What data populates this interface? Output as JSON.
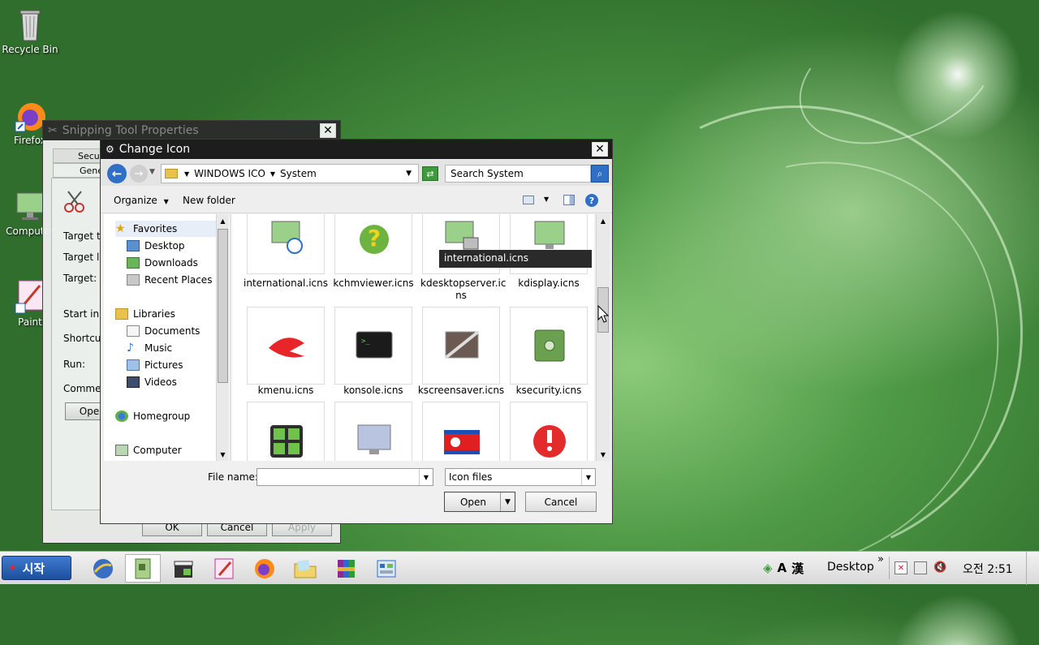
{
  "desktop": {
    "icons": [
      {
        "label": "Recycle Bin"
      },
      {
        "label": "Firefox"
      },
      {
        "label": "Computer"
      },
      {
        "label": "Paint"
      }
    ]
  },
  "snipping_props": {
    "title": "Snipping Tool Properties",
    "tabs": [
      "Securi",
      "Gene"
    ],
    "fields": [
      "Target ty",
      "Target lc",
      "Target:",
      "Start in:",
      "Shortcut",
      "Run:",
      "Commer"
    ],
    "open_button": "Ope",
    "buttons": [
      "OK",
      "Cancel",
      "Apply"
    ]
  },
  "change_icon": {
    "title": "Change Icon",
    "breadcrumb": [
      "WINDOWS ICO",
      "System"
    ],
    "search_placeholder": "Search System",
    "toolbar": {
      "organize": "Organize",
      "new_folder": "New folder"
    },
    "nav": {
      "favorites": "Favorites",
      "favorites_items": [
        "Desktop",
        "Downloads",
        "Recent Places"
      ],
      "libraries": "Libraries",
      "libraries_items": [
        "Documents",
        "Music",
        "Pictures",
        "Videos"
      ],
      "homegroup": "Homegroup",
      "computer": "Computer"
    },
    "files_row1": [
      "international.icns",
      "kchmviewer.icns",
      "kdesktopserver.ic ns",
      "kdisplay.icns"
    ],
    "files_row2": [
      "kmenu.icns",
      "konsole.icns",
      "kscreensaver.icns",
      "ksecurity.icns"
    ],
    "tooltip": "international.icns",
    "file_name_label": "File name:",
    "file_name_value": "",
    "file_type": "Icon files",
    "open_label": "Open",
    "cancel_label": "Cancel"
  },
  "taskbar": {
    "start_label": "시작",
    "tray_lang1": "A",
    "tray_lang2": "漢",
    "desktop_label": "Desktop",
    "chevron": "»",
    "clock": "오전 2:51"
  }
}
